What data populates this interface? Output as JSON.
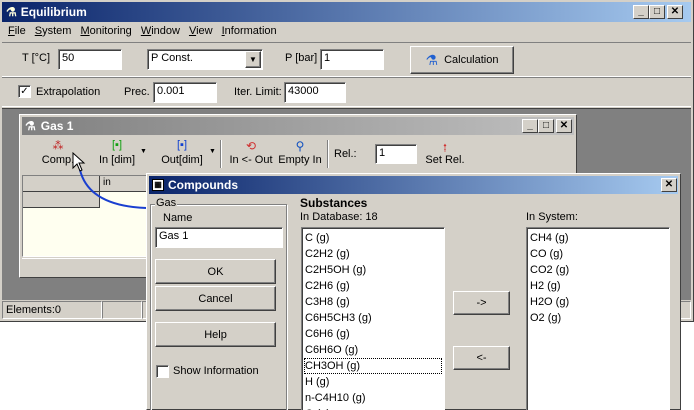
{
  "app": {
    "title": "Equilibrium",
    "menu": [
      "File",
      "System",
      "Monitoring",
      "Window",
      "View",
      "Information"
    ]
  },
  "toolbar1": {
    "temp_label": "T [°C]",
    "temp_value": "50",
    "mode_value": "P Const.",
    "pressure_label": "P [bar]",
    "pressure_value": "1",
    "calc_label": "Calculation"
  },
  "toolbar2": {
    "extrapolation_label": "Extrapolation",
    "extrapolation_checked": true,
    "prec_label": "Prec.",
    "prec_value": "0.001",
    "iter_label": "Iter. Limit:",
    "iter_value": "43000"
  },
  "gas_window": {
    "title": "Gas 1",
    "tools": {
      "comp": "Comp.",
      "in_dim": "In [dim]",
      "out_dim": "Out[dim]",
      "in_out": "In <- Out",
      "empty_in": "Empty In",
      "rel_label": "Rel.:",
      "rel_value": "1",
      "set_rel": "Set Rel."
    },
    "grid_header_col": "in"
  },
  "status": {
    "elements": "Elements:0"
  },
  "dialog": {
    "title": "Compounds",
    "gas_group": "Gas",
    "name_label": "Name",
    "name_value": "Gas 1",
    "ok": "OK",
    "cancel": "Cancel",
    "help": "Help",
    "show_info": "Show Information",
    "substances_heading": "Substances",
    "in_database": "In Database: 18",
    "in_system": "In System:",
    "add": "->",
    "remove": "<-",
    "database_items": [
      "C (g)",
      "C2H2 (g)",
      "C2H5OH (g)",
      "C2H6 (g)",
      "C3H8 (g)",
      "C6H5CH3 (g)",
      "C6H6 (g)",
      "C6H6O (g)",
      "CH3OH (g)",
      "H (g)",
      "n-C4H10 (g)",
      "O (g)"
    ],
    "system_items": [
      "CH4 (g)",
      "CO (g)",
      "CO2 (g)",
      "H2 (g)",
      "H2O (g)",
      "O2 (g)"
    ],
    "focused_index": 8
  }
}
